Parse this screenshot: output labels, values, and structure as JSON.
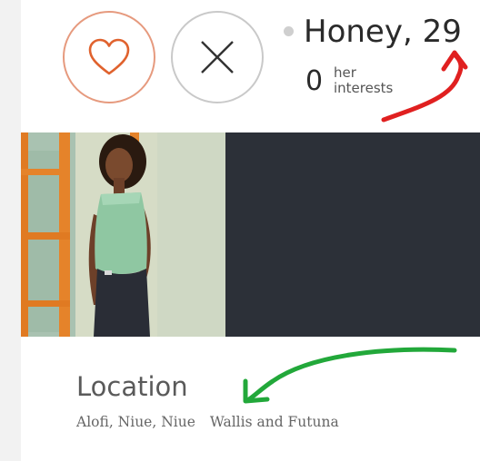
{
  "profile": {
    "name_age": "Honey, 29",
    "interests_count": "0",
    "interests_label": "her interests"
  },
  "actions": {
    "like_icon": "heart-icon",
    "dismiss_icon": "close-icon"
  },
  "location": {
    "heading": "Location",
    "primary": "Alofi, Niue, Niue",
    "secondary": "Wallis and Futuna"
  },
  "colors": {
    "like_accent": "#e0622e",
    "photo_panel": "#2c3038",
    "annotation_red": "#e02020",
    "annotation_green": "#22a83a"
  }
}
